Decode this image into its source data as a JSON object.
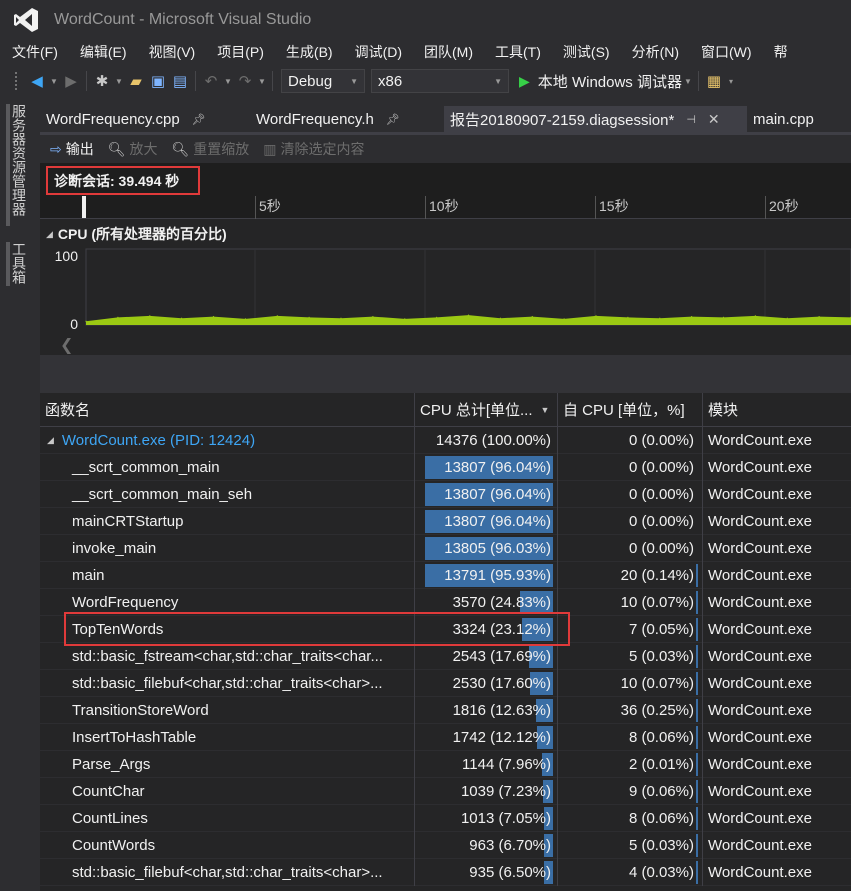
{
  "window": {
    "title": "WordCount - Microsoft Visual Studio"
  },
  "menu": [
    "文件(F)",
    "编辑(E)",
    "视图(V)",
    "项目(P)",
    "生成(B)",
    "调试(D)",
    "团队(M)",
    "工具(T)",
    "测试(S)",
    "分析(N)",
    "窗口(W)",
    "帮"
  ],
  "toolbar": {
    "configuration": "Debug",
    "platform": "x86",
    "run_label": "本地 Windows 调试器"
  },
  "sidebar": {
    "server_explorer": "服务器资源管理器",
    "toolbox": "工具箱"
  },
  "tabs": [
    {
      "label": "WordFrequency.cpp",
      "pinned": true
    },
    {
      "label": "WordFrequency.h",
      "pinned": true
    },
    {
      "label": "报告20180907-2159.diagsession*",
      "pinned": true,
      "active": true
    },
    {
      "label": "main.cpp"
    }
  ],
  "diag_toolbar": {
    "output": "输出",
    "zoom_in": "放大",
    "reset_zoom": "重置缩放",
    "clear_selection": "清除选定内容"
  },
  "session": {
    "label": "诊断会话: 39.494 秒"
  },
  "ruler": [
    "5秒",
    "10秒",
    "15秒",
    "20秒"
  ],
  "cpu_graph": {
    "title": "CPU (所有处理器的百分比)",
    "ymax_label": "100",
    "ymin_label": "0"
  },
  "chart_data": {
    "type": "area",
    "title": "CPU (所有处理器的百分比)",
    "xlabel": "",
    "ylabel": "",
    "ylim": [
      0,
      100
    ],
    "x_ticks": [
      "5秒",
      "10秒",
      "15秒",
      "20秒"
    ],
    "x": [
      0,
      1,
      2,
      3,
      4,
      5,
      6,
      7,
      8,
      9,
      10,
      11,
      12,
      13,
      14,
      15,
      16,
      17,
      18,
      19,
      20,
      21,
      22,
      23,
      24
    ],
    "values": [
      5,
      10,
      12,
      9,
      11,
      8,
      12,
      10,
      9,
      11,
      8,
      10,
      13,
      9,
      11,
      8,
      12,
      10,
      9,
      11,
      10,
      12,
      9,
      11,
      10
    ]
  },
  "table": {
    "headers": {
      "name": "函数名",
      "total": "CPU 总计[单位...",
      "self": "自 CPU [单位，%]",
      "module": "模块"
    },
    "rows": [
      {
        "name": "WordCount.exe (PID: 12424)",
        "total": "14376 (100.00%)",
        "total_pct": 100.0,
        "self": "0 (0.00%)",
        "self_pct": 0.0,
        "module": "WordCount.exe",
        "root": true
      },
      {
        "name": "__scrt_common_main",
        "total": "13807 (96.04%)",
        "total_pct": 96.04,
        "self": "0 (0.00%)",
        "self_pct": 0.0,
        "module": "WordCount.exe"
      },
      {
        "name": "__scrt_common_main_seh",
        "total": "13807 (96.04%)",
        "total_pct": 96.04,
        "self": "0 (0.00%)",
        "self_pct": 0.0,
        "module": "WordCount.exe"
      },
      {
        "name": "mainCRTStartup",
        "total": "13807 (96.04%)",
        "total_pct": 96.04,
        "self": "0 (0.00%)",
        "self_pct": 0.0,
        "module": "WordCount.exe"
      },
      {
        "name": "invoke_main",
        "total": "13805 (96.03%)",
        "total_pct": 96.03,
        "self": "0 (0.00%)",
        "self_pct": 0.0,
        "module": "WordCount.exe"
      },
      {
        "name": "main",
        "total": "13791 (95.93%)",
        "total_pct": 95.93,
        "self": "20 (0.14%)",
        "self_pct": 0.14,
        "module": "WordCount.exe"
      },
      {
        "name": "WordFrequency",
        "total": "3570 (24.83%)",
        "total_pct": 24.83,
        "self": "10 (0.07%)",
        "self_pct": 0.07,
        "module": "WordCount.exe"
      },
      {
        "name": "TopTenWords",
        "total": "3324 (23.12%)",
        "total_pct": 23.12,
        "self": "7 (0.05%)",
        "self_pct": 0.05,
        "module": "WordCount.exe"
      },
      {
        "name": "std::basic_fstream<char,std::char_traits<char...",
        "total": "2543 (17.69%)",
        "total_pct": 17.69,
        "self": "5 (0.03%)",
        "self_pct": 0.03,
        "module": "WordCount.exe"
      },
      {
        "name": "std::basic_filebuf<char,std::char_traits<char>...",
        "total": "2530 (17.60%)",
        "total_pct": 17.6,
        "self": "10 (0.07%)",
        "self_pct": 0.07,
        "module": "WordCount.exe"
      },
      {
        "name": "TransitionStoreWord",
        "total": "1816 (12.63%)",
        "total_pct": 12.63,
        "self": "36 (0.25%)",
        "self_pct": 0.25,
        "module": "WordCount.exe"
      },
      {
        "name": "InsertToHashTable",
        "total": "1742 (12.12%)",
        "total_pct": 12.12,
        "self": "8 (0.06%)",
        "self_pct": 0.06,
        "module": "WordCount.exe"
      },
      {
        "name": "Parse_Args",
        "total": "1144 (7.96%)",
        "total_pct": 7.96,
        "self": "2 (0.01%)",
        "self_pct": 0.01,
        "module": "WordCount.exe"
      },
      {
        "name": "CountChar",
        "total": "1039 (7.23%)",
        "total_pct": 7.23,
        "self": "9 (0.06%)",
        "self_pct": 0.06,
        "module": "WordCount.exe"
      },
      {
        "name": "CountLines",
        "total": "1013 (7.05%)",
        "total_pct": 7.05,
        "self": "8 (0.06%)",
        "self_pct": 0.06,
        "module": "WordCount.exe"
      },
      {
        "name": "CountWords",
        "total": "963 (6.70%)",
        "total_pct": 6.7,
        "self": "5 (0.03%)",
        "self_pct": 0.03,
        "module": "WordCount.exe"
      },
      {
        "name": "std::basic_filebuf<char,std::char_traits<char>...",
        "total": "935 (6.50%)",
        "total_pct": 6.5,
        "self": "4 (0.03%)",
        "self_pct": 0.03,
        "module": "WordCount.exe"
      }
    ]
  },
  "colors": {
    "accent": "#3ea6f5",
    "bar": "#3a6ea5",
    "cpu_fill": "#9bc913",
    "highlight": "#e03a3a",
    "play": "#37d048"
  }
}
